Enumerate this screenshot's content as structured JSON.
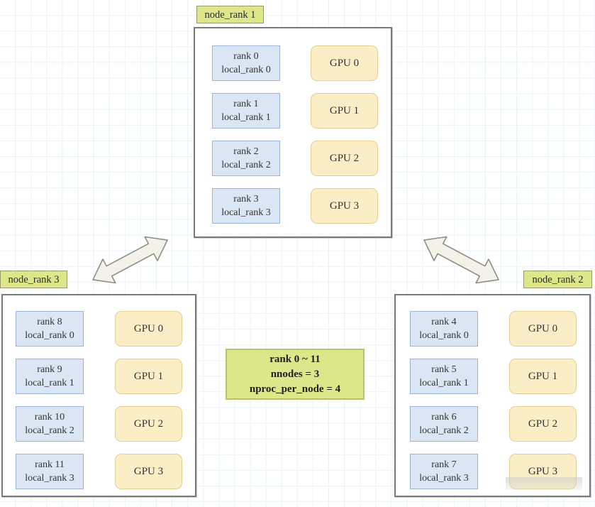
{
  "diagram": {
    "title": "Distributed training rank / node layout",
    "colors": {
      "node_border": "#7a7a7a",
      "label_fill": "#dde78a",
      "rank_fill": "#dbe6f5",
      "rank_border": "#9cb4d8",
      "gpu_fill": "#fbeec6",
      "gpu_border": "#e0cf93",
      "grid": "#e6f4f7",
      "arrow_fill": "#f2f0e6",
      "arrow_stroke": "#8d8d82"
    },
    "summary": {
      "line1": "rank 0 ~ 11",
      "line2": "nnodes = 3",
      "line3": "nproc_per_node = 4"
    },
    "nodes": [
      {
        "label": "node_rank 1",
        "ranks": [
          {
            "rank": "rank 0",
            "local_rank": "local_rank 0"
          },
          {
            "rank": "rank 1",
            "local_rank": "local_rank 1"
          },
          {
            "rank": "rank 2",
            "local_rank": "local_rank 2"
          },
          {
            "rank": "rank 3",
            "local_rank": "local_rank 3"
          }
        ],
        "gpus": [
          "GPU 0",
          "GPU 1",
          "GPU 2",
          "GPU 3"
        ]
      },
      {
        "label": "node_rank 3",
        "ranks": [
          {
            "rank": "rank 8",
            "local_rank": "local_rank 0"
          },
          {
            "rank": "rank 9",
            "local_rank": "local_rank 1"
          },
          {
            "rank": "rank 10",
            "local_rank": "local_rank 2"
          },
          {
            "rank": "rank 11",
            "local_rank": "local_rank 3"
          }
        ],
        "gpus": [
          "GPU 0",
          "GPU 1",
          "GPU 2",
          "GPU 3"
        ]
      },
      {
        "label": "node_rank 2",
        "ranks": [
          {
            "rank": "rank 4",
            "local_rank": "local_rank 0"
          },
          {
            "rank": "rank 5",
            "local_rank": "local_rank 1"
          },
          {
            "rank": "rank 6",
            "local_rank": "local_rank 2"
          },
          {
            "rank": "rank 7",
            "local_rank": "local_rank 3"
          }
        ],
        "gpus": [
          "GPU 0",
          "GPU 1",
          "GPU 2",
          "GPU 3"
        ]
      }
    ],
    "connectors": [
      {
        "name": "double-arrow-top-left",
        "direction": "bidirectional"
      },
      {
        "name": "double-arrow-top-right",
        "direction": "bidirectional"
      }
    ]
  }
}
